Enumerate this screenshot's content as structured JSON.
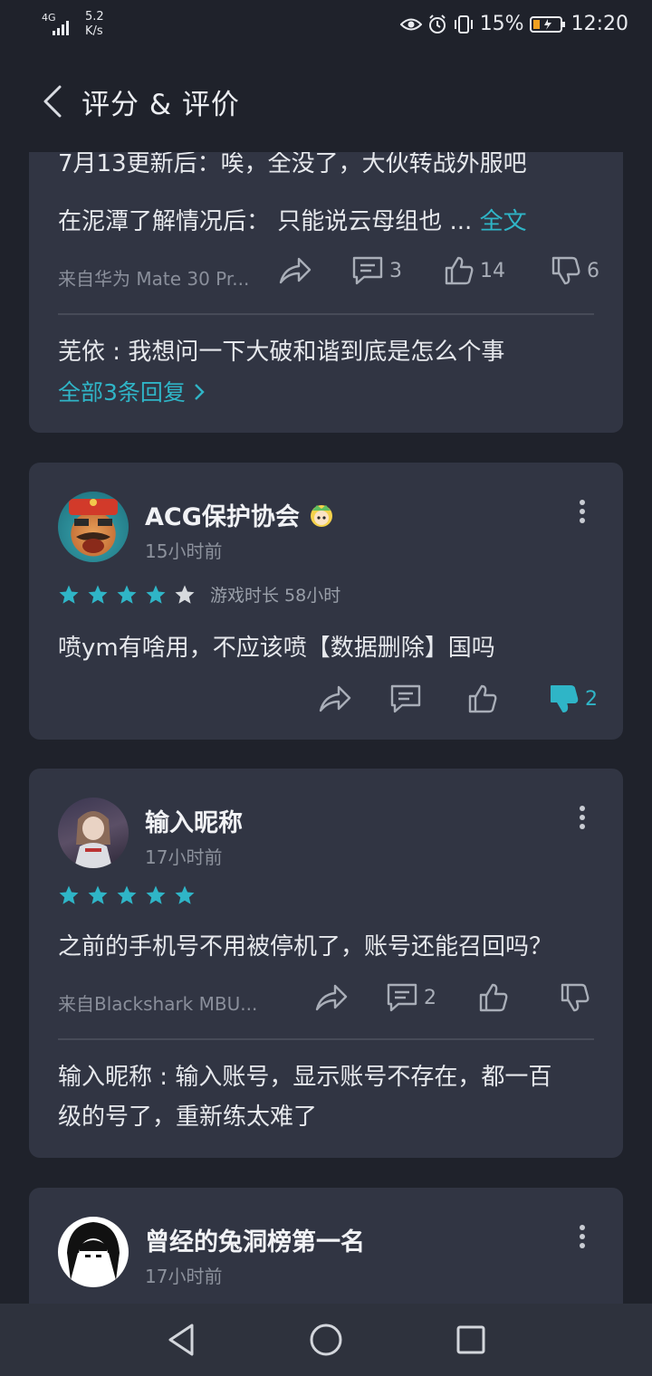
{
  "status": {
    "network": "4G",
    "speed_value": "5.2",
    "speed_unit": "K/s",
    "battery": "15%",
    "time": "12:20"
  },
  "header": {
    "title": "评分 & 评价"
  },
  "review1": {
    "line1": "7月13更新后：唉，全没了，大伙转战外服吧",
    "line2": "在泥潭了解情况后： 只能说云母组也 ...",
    "full_text_link": "全文",
    "device": "来自华为 Mate 30 Pr...",
    "comments": "3",
    "likes": "14",
    "dislikes": "6",
    "reply_author": "芜依",
    "reply_sep": " : ",
    "reply_text": "我想问一下大破和谐到底是怎么个事",
    "all_replies": "全部3条回复"
  },
  "review2": {
    "username": "ACG保护协会",
    "time": "15小时前",
    "rating": 4,
    "playtime": "游戏时长 58小时",
    "content": "喷ym有啥用，不应该喷【数据删除】国吗",
    "dislikes": "2"
  },
  "review3": {
    "username": "输入昵称",
    "time": "17小时前",
    "rating": 5,
    "content": "之前的手机号不用被停机了，账号还能召回吗？",
    "device": "来自Blackshark MBU...",
    "comments": "2",
    "reply_author": "输入昵称",
    "reply_sep": " : ",
    "reply_line1": "输入账号，显示账号不存在，都一百",
    "reply_line2": "级的号了，重新练太难了"
  },
  "review4": {
    "username": "曾经的兔洞榜第一名",
    "time": "17小时前"
  },
  "colors": {
    "accent": "#2fb5c7",
    "card": "#313543",
    "background": "#1f222b"
  }
}
